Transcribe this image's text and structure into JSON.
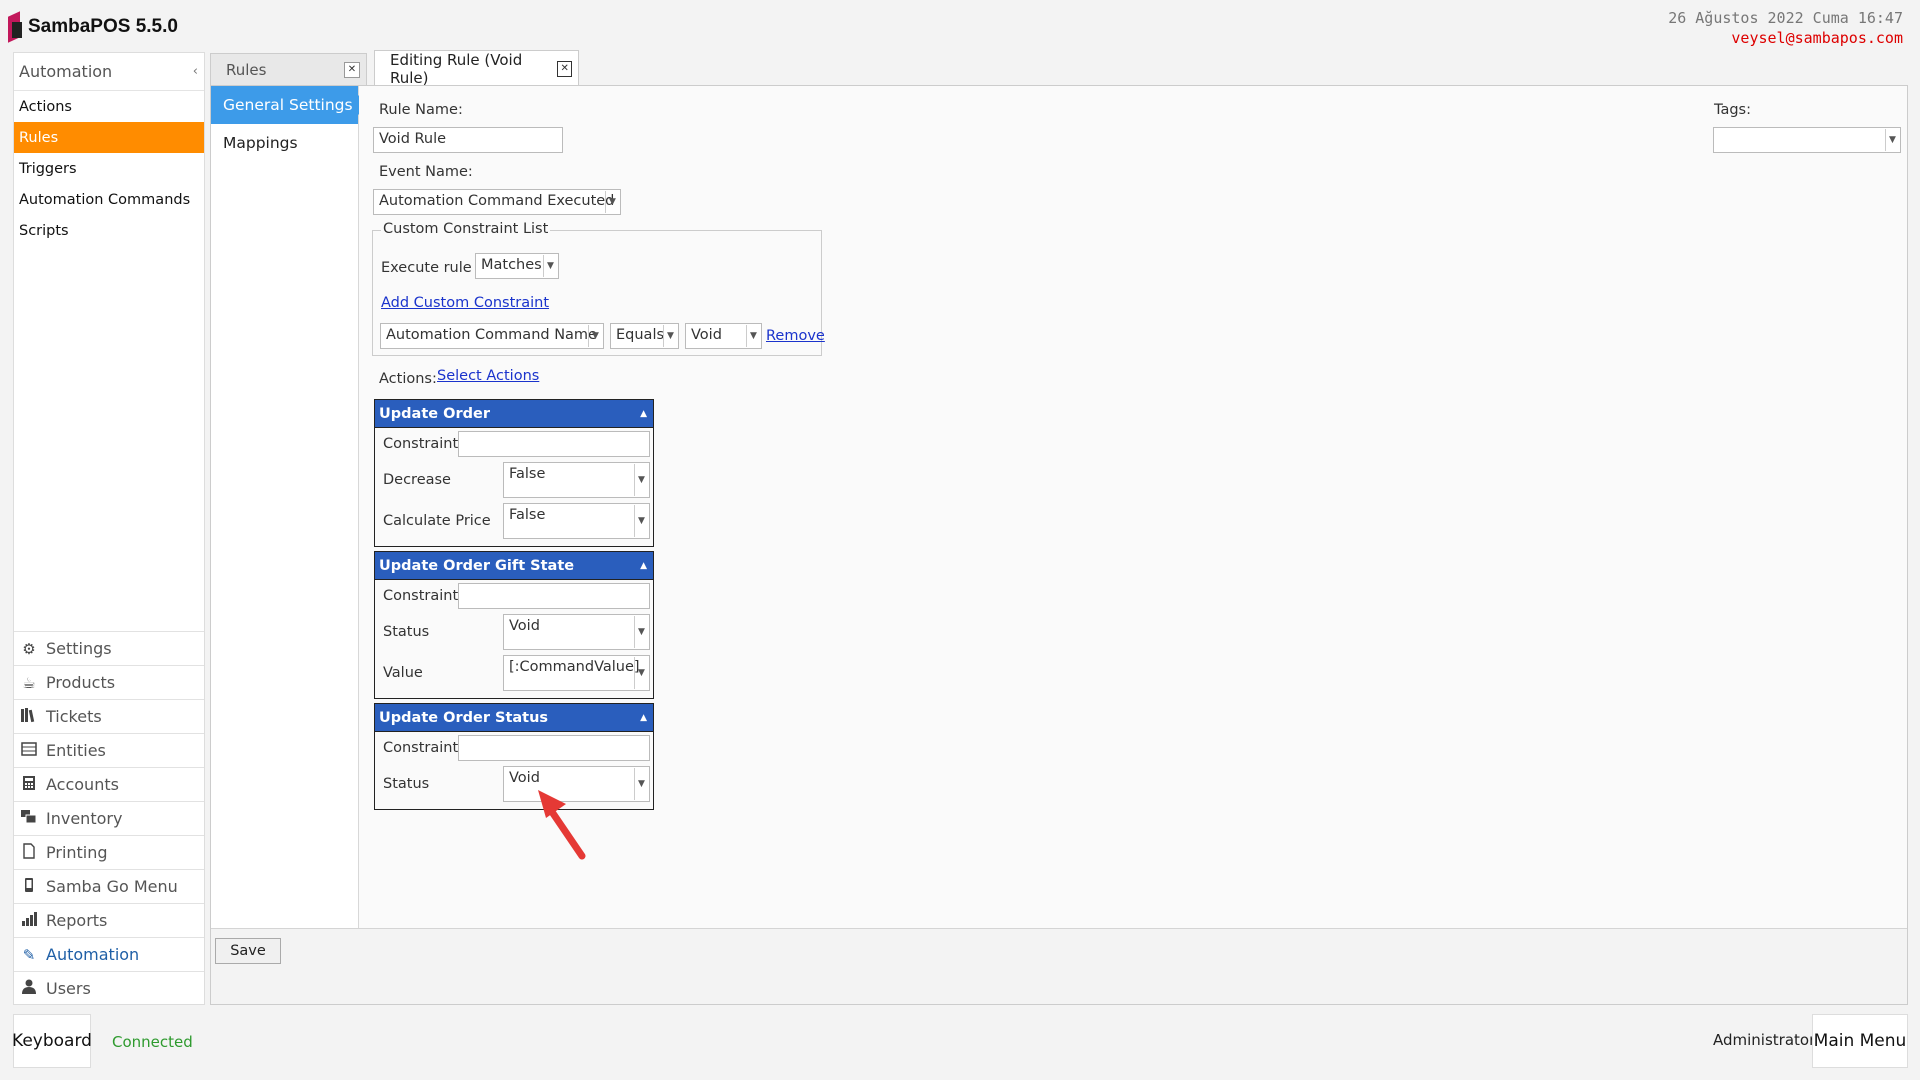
{
  "app": {
    "title": "SambaPOS 5.5.0"
  },
  "header": {
    "datetime": "26 Ağustos 2022 Cuma 16:47",
    "user_email": "veysel@sambapos.com"
  },
  "leftnav": {
    "title": "Automation",
    "items": [
      {
        "label": "Actions"
      },
      {
        "label": "Rules",
        "active": true
      },
      {
        "label": "Triggers"
      },
      {
        "label": "Automation Commands"
      },
      {
        "label": "Scripts"
      }
    ],
    "menu": [
      {
        "label": "Settings",
        "icon": "gear-icon"
      },
      {
        "label": "Products",
        "icon": "coffee-icon"
      },
      {
        "label": "Tickets",
        "icon": "books-icon"
      },
      {
        "label": "Entities",
        "icon": "table-icon"
      },
      {
        "label": "Accounts",
        "icon": "calculator-icon"
      },
      {
        "label": "Inventory",
        "icon": "stack-icon"
      },
      {
        "label": "Printing",
        "icon": "document-icon"
      },
      {
        "label": "Samba Go Menu",
        "icon": "mobile-icon"
      },
      {
        "label": "Reports",
        "icon": "bar-chart-icon"
      },
      {
        "label": "Automation",
        "icon": "pen-icon",
        "active": true
      },
      {
        "label": "Users",
        "icon": "user-icon"
      }
    ]
  },
  "tabs": [
    {
      "label": "Rules",
      "active": false
    },
    {
      "label": "Editing Rule (Void Rule)",
      "active": true
    }
  ],
  "subnav": [
    {
      "label": "General Settings",
      "active": true
    },
    {
      "label": "Mappings"
    }
  ],
  "form": {
    "rule_name_label": "Rule Name:",
    "rule_name_value": "Void Rule",
    "event_name_label": "Event Name:",
    "event_name_value": "Automation Command Executed",
    "tags_label": "Tags:",
    "tags_value": "",
    "constraints": {
      "title": "Custom Constraint List",
      "execute_label": "Execute rule if",
      "execute_value": "Matches",
      "add_link": "Add Custom Constraint",
      "row": {
        "field": "Automation Command Name",
        "operator": "Equals",
        "value": "Void",
        "remove": "Remove"
      }
    },
    "actions_label": "Actions:",
    "select_actions_link": "Select Actions",
    "constraint_label": "Constraint:",
    "actions": [
      {
        "title": "Update Order",
        "params": [
          {
            "label": "Decrease",
            "value": "False"
          },
          {
            "label": "Calculate Price",
            "value": "False"
          }
        ]
      },
      {
        "title": "Update Order Gift State",
        "params": [
          {
            "label": "Status",
            "value": "Void"
          },
          {
            "label": "Value",
            "value": "[:CommandValue]"
          }
        ]
      },
      {
        "title": "Update Order Status",
        "params": [
          {
            "label": "Status",
            "value": "Void"
          }
        ]
      }
    ],
    "save_label": "Save"
  },
  "statusbar": {
    "keyboard_label": "Keyboard",
    "connection_status": "Connected",
    "connection_color": "#2e9a2e",
    "user": "Administrator",
    "main_menu_label": "Main Menu"
  },
  "colors": {
    "accent_orange": "#ff8c00",
    "accent_blue": "#3d9be9",
    "action_header": "#2a5ebd"
  }
}
